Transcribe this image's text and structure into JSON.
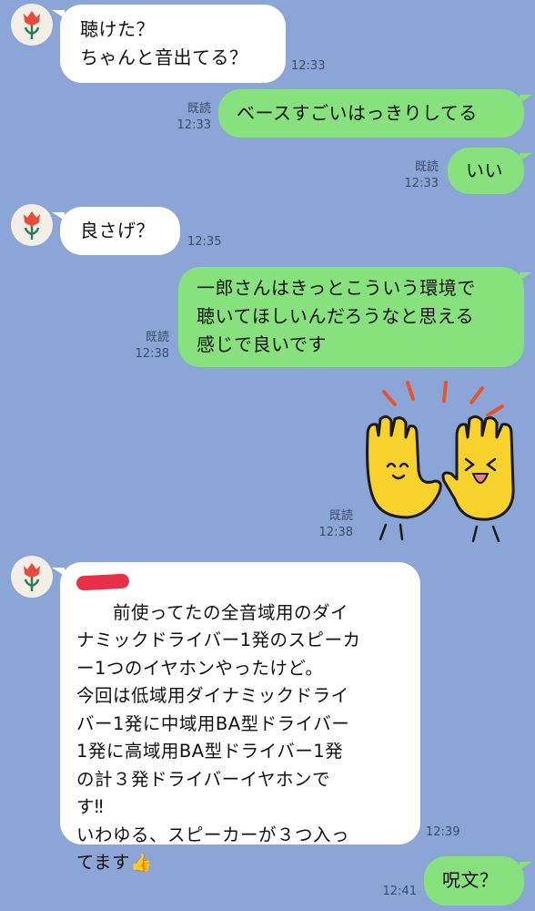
{
  "colors": {
    "background": "#8aa5d6",
    "incoming_bubble": "#ffffff",
    "outgoing_bubble": "#87e27d",
    "meta_text": "#3c4c68",
    "redaction": "#e8304a"
  },
  "icons": {
    "avatar": "red-tulip-icon",
    "sticker": "yellow-gloves-high-five-sticker"
  },
  "messages": [
    {
      "direction": "in",
      "text": "聴けた？\nちゃんと音出てる？",
      "time": "12:33"
    },
    {
      "direction": "out",
      "text": "ベースすごいはっきりしてる",
      "read": "既読",
      "time": "12:33"
    },
    {
      "direction": "out",
      "text": "いい",
      "read": "既読",
      "time": "12:33"
    },
    {
      "direction": "in",
      "text": "良さげ？",
      "time": "12:35"
    },
    {
      "direction": "out",
      "text": "一郎さんはきっとこういう環境で\n聴いてほしいんだろうなと思える\n感じで良いです",
      "read": "既読",
      "time": "12:38"
    },
    {
      "direction": "out",
      "type": "sticker",
      "read": "既読",
      "time": "12:38"
    },
    {
      "direction": "in",
      "text": "　　前使ってたの全音域用のダイ\nナミックドライバー1発のスピーカ\nー1つのイヤホンやったけど。\n今回は低域用ダイナミックドライ\nバー1発に中域用BA型ドライバー\n1発に高域用BA型ドライバー1発\nの計３発ドライバーイヤホンで\nす‼︎\nいわゆる、スピーカーが３つ入っ\nてます",
      "emoji": "👍",
      "time": "12:39"
    },
    {
      "direction": "out",
      "text": "呪文？",
      "time": "12:41"
    }
  ]
}
